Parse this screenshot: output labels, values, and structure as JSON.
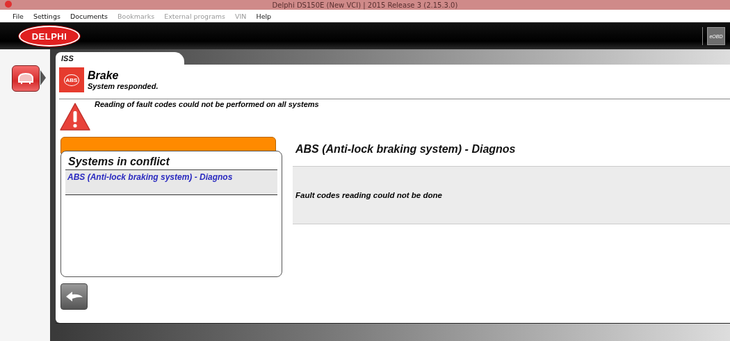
{
  "window": {
    "title": "Delphi DS150E (New VCI) | 2015 Release 3 (2.15.3.0)"
  },
  "menu": [
    {
      "label": "File",
      "disabled": false
    },
    {
      "label": "Settings",
      "disabled": false
    },
    {
      "label": "Documents",
      "disabled": false
    },
    {
      "label": "Bookmarks",
      "disabled": true
    },
    {
      "label": "External programs",
      "disabled": true
    },
    {
      "label": "VIN",
      "disabled": true
    },
    {
      "label": "Help",
      "disabled": false
    }
  ],
  "header": {
    "logo": "DELPHI",
    "mode_button": "eOBD"
  },
  "tab": {
    "label": "ISS"
  },
  "system": {
    "name": "Brake",
    "badge": "ABS",
    "status": "System responded."
  },
  "warning": {
    "message": "Reading of fault codes could not be performed on all systems"
  },
  "conflicts": {
    "title": "Systems in conflict",
    "items": [
      {
        "label": "ABS (Anti-lock braking system) - Diagnos",
        "selected": true
      }
    ]
  },
  "detail": {
    "title": "ABS (Anti-lock braking system) - Diagnos",
    "message": "Fault codes reading could not be done"
  }
}
